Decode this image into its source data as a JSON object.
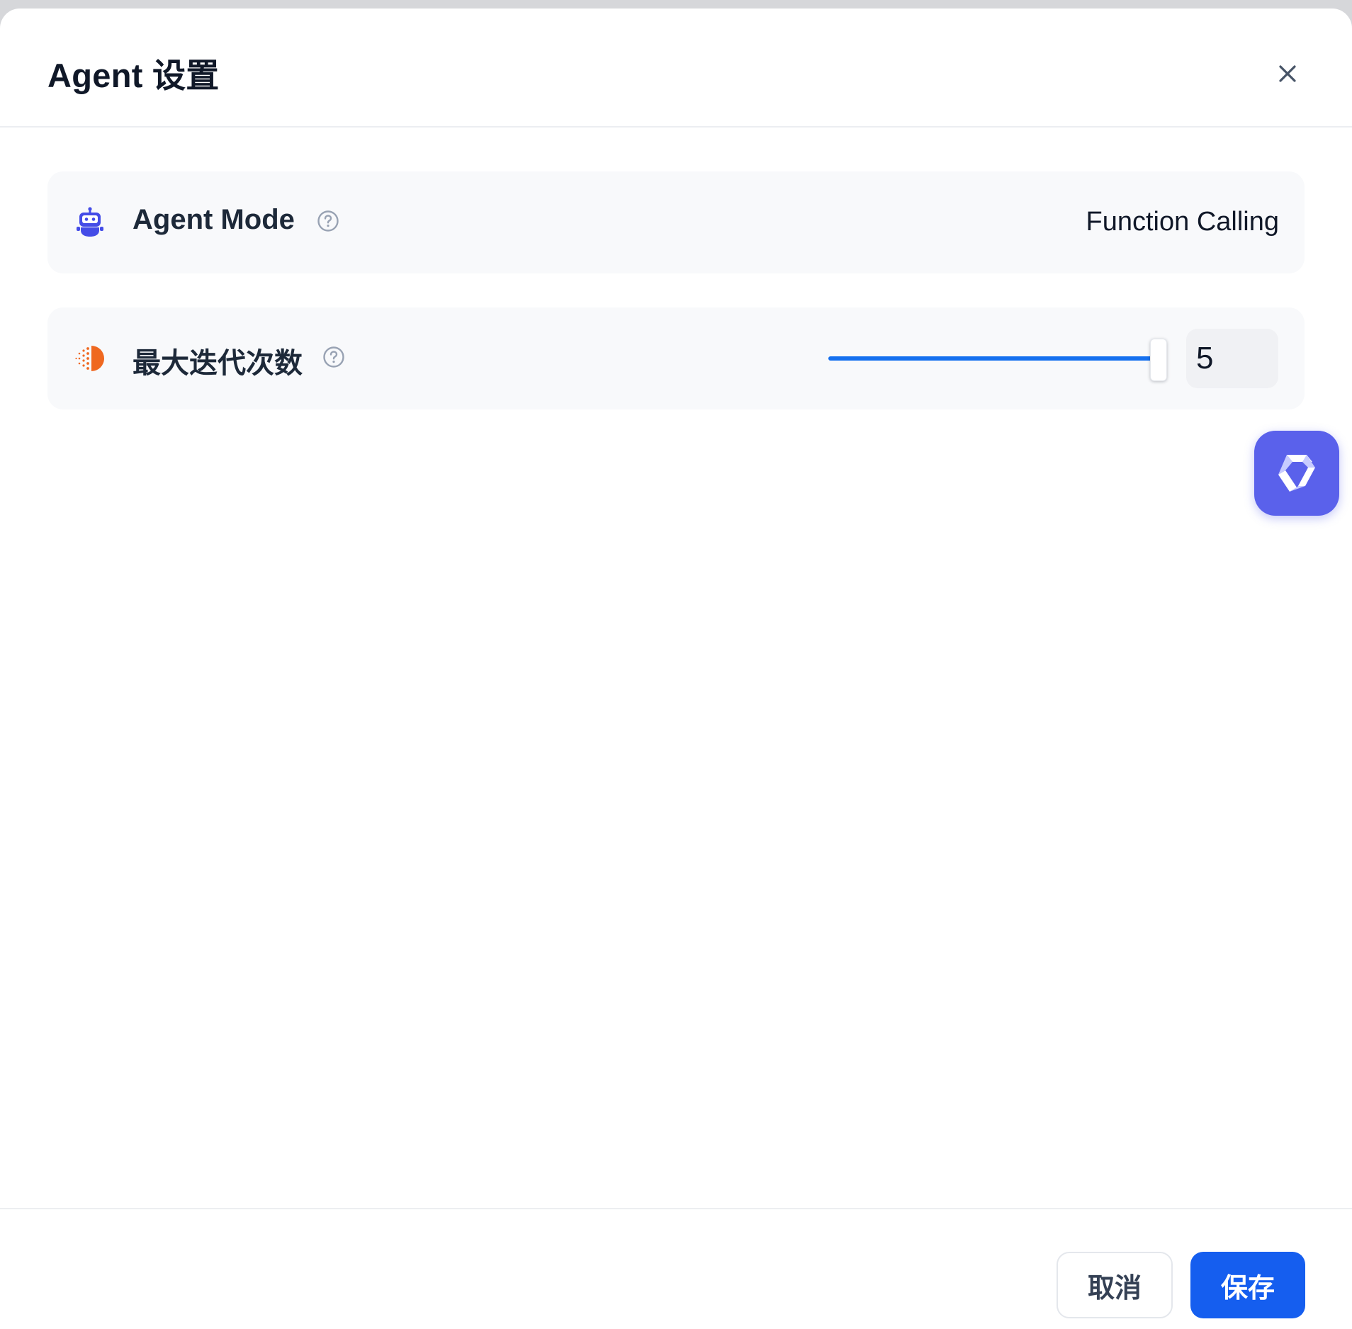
{
  "modal": {
    "title": "Agent 设置"
  },
  "settings": {
    "agent_mode": {
      "label": "Agent Mode",
      "icon": "robot-icon",
      "value": "Function Calling"
    },
    "max_iterations": {
      "label": "最大迭代次数",
      "icon": "iteration-icon",
      "value": "5",
      "slider_fraction": 0.98
    }
  },
  "footer": {
    "cancel_label": "取消",
    "save_label": "保存"
  },
  "colors": {
    "accent": "#155eef",
    "slider": "#1570ef",
    "robot_icon": "#444ce7",
    "iteration_icon": "#ef6820",
    "assistant_bubble": "#5a61eb"
  }
}
